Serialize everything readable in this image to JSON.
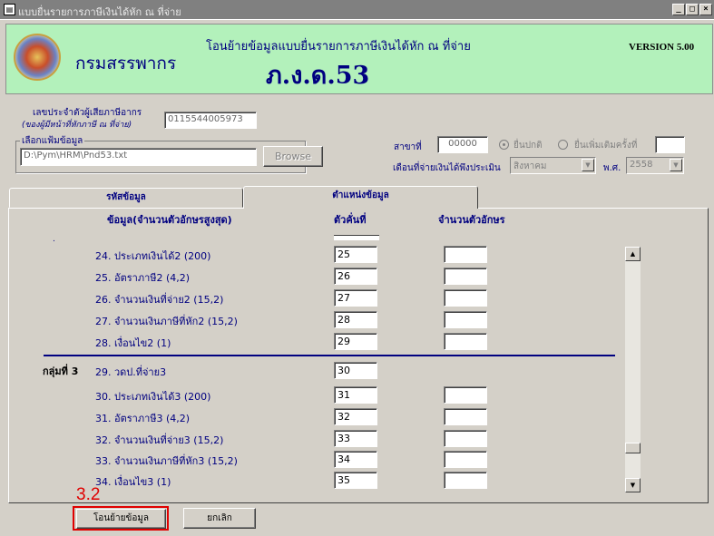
{
  "window": {
    "title": "แบบยื่นรายการภาษีเงินได้หัก ณ ที่จ่าย",
    "controls": [
      "_",
      "□",
      "×"
    ]
  },
  "header": {
    "org_name": "กรมสรรพากร",
    "subtitle": "โอนย้ายข้อมูลแบบยื่นรายการภาษีเงินได้หัก ณ ที่จ่าย",
    "form_name": "ภ.ง.ด.53",
    "version": "VERSION 5.00"
  },
  "taxpayer": {
    "label": "เลขประจำตัวผู้เสียภาษีอากร",
    "sublabel": "(ของผู้มีหน้าที่หักภาษี ณ ที่จ่าย)",
    "value": "0115544005973"
  },
  "file": {
    "group_label": "เลือกแฟ้มข้อมูล",
    "path": "D:\\Pym\\HRM\\Pnd53.txt",
    "browse_label": "Browse"
  },
  "branch": {
    "label": "สาขาที่",
    "value": "00000"
  },
  "filing": {
    "normal_label": "ยื่นปกติ",
    "additional_label": "ยื่นเพิ่มเติมครั้งที่",
    "additional_value": ""
  },
  "period": {
    "label": "เดือนที่จ่ายเงินได้พึงประเมิน",
    "month": "สิงหาคม",
    "year_label": "พ.ศ.",
    "year": "2558"
  },
  "tabs": [
    {
      "label": "รหัสข้อมูล"
    },
    {
      "label": "ตำแหน่งข้อมูล"
    }
  ],
  "columns": {
    "data": "ข้อมูล(จำนวนตัวอักษรสูงสุด)",
    "position": "ตัวคั่นที่",
    "length": "จำนวนตัวอักษร"
  },
  "group_label": "กลุ่มที่ 3",
  "rows": [
    {
      "label": "24. ประเภทเงินได้2 (200)",
      "position": "25",
      "length": ""
    },
    {
      "label": "25. อัตราภาษี2 (4,2)",
      "position": "26",
      "length": ""
    },
    {
      "label": "26. จำนวนเงินที่จ่าย2 (15,2)",
      "position": "27",
      "length": ""
    },
    {
      "label": "27. จำนวนเงินภาษีที่หัก2 (15,2)",
      "position": "28",
      "length": ""
    },
    {
      "label": "28. เงื่อนไข2 (1)",
      "position": "29",
      "length": ""
    },
    {
      "label": "29. วดป.ที่จ่าย3",
      "position": "30",
      "length": ""
    },
    {
      "label": "30. ประเภทเงินได้3 (200)",
      "position": "31",
      "length": ""
    },
    {
      "label": "31. อัตราภาษี3 (4,2)",
      "position": "32",
      "length": ""
    },
    {
      "label": "32. จำนวนเงินที่จ่าย3 (15,2)",
      "position": "33",
      "length": ""
    },
    {
      "label": "33. จำนวนเงินภาษีที่หัก3 (15,2)",
      "position": "34",
      "length": ""
    },
    {
      "label": "34. เงื่อนไข3 (1)",
      "position": "35",
      "length": ""
    }
  ],
  "scroll_position": 0.88,
  "buttons": {
    "transfer": "โอนย้ายข้อมูล",
    "cancel": "ยกเลิก"
  },
  "annotation": {
    "step": "3.2",
    "color": "#e00000"
  }
}
